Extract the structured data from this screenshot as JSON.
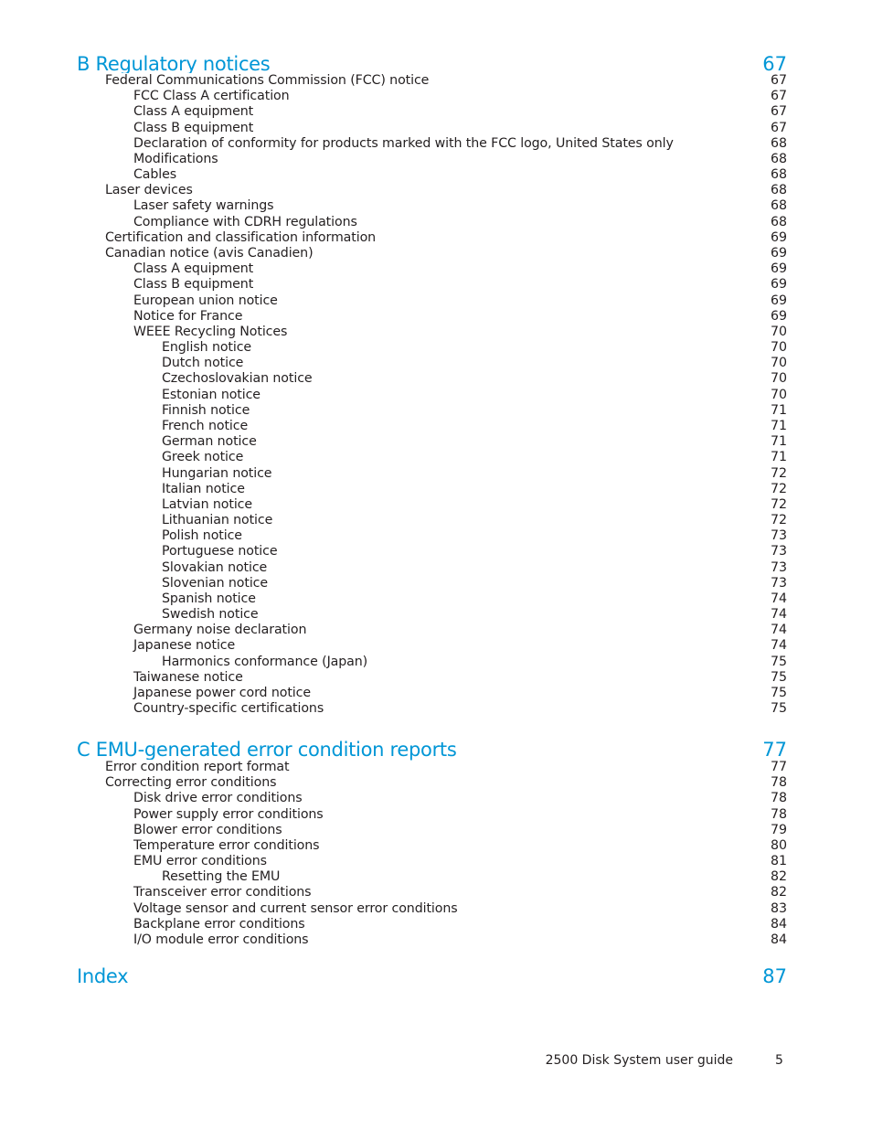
{
  "document": {
    "footer_title": "2500 Disk System user guide",
    "page_number": "5",
    "accent_color": "#0096d6"
  },
  "toc": [
    {
      "level": 0,
      "title": "B Regulatory notices",
      "page": "67"
    },
    {
      "level": 1,
      "title": "Federal Communications Commission (FCC) notice",
      "page": "67"
    },
    {
      "level": 2,
      "title": "FCC Class A certification",
      "page": "67"
    },
    {
      "level": 2,
      "title": "Class A equipment",
      "page": "67"
    },
    {
      "level": 2,
      "title": "Class B equipment",
      "page": "67"
    },
    {
      "level": 2,
      "title": "Declaration of conformity for products marked with the FCC logo, United States only",
      "page": "68"
    },
    {
      "level": 2,
      "title": "Modifications",
      "page": "68"
    },
    {
      "level": 2,
      "title": "Cables",
      "page": "68"
    },
    {
      "level": 1,
      "title": "Laser devices",
      "page": "68"
    },
    {
      "level": 2,
      "title": "Laser safety warnings",
      "page": "68"
    },
    {
      "level": 2,
      "title": "Compliance with CDRH regulations",
      "page": "68"
    },
    {
      "level": 1,
      "title": "Certification and classification information",
      "page": "69"
    },
    {
      "level": 1,
      "title": "Canadian notice (avis Canadien)",
      "page": "69"
    },
    {
      "level": 2,
      "title": "Class A equipment",
      "page": "69"
    },
    {
      "level": 2,
      "title": "Class B equipment",
      "page": "69"
    },
    {
      "level": 2,
      "title": "European union notice",
      "page": "69"
    },
    {
      "level": 2,
      "title": "Notice for France",
      "page": "69"
    },
    {
      "level": 2,
      "title": "WEEE Recycling Notices",
      "page": "70"
    },
    {
      "level": 3,
      "title": "English notice",
      "page": "70"
    },
    {
      "level": 3,
      "title": "Dutch notice",
      "page": "70"
    },
    {
      "level": 3,
      "title": "Czechoslovakian notice",
      "page": "70"
    },
    {
      "level": 3,
      "title": "Estonian notice",
      "page": "70"
    },
    {
      "level": 3,
      "title": "Finnish notice",
      "page": "71"
    },
    {
      "level": 3,
      "title": "French notice",
      "page": "71"
    },
    {
      "level": 3,
      "title": "German notice",
      "page": "71"
    },
    {
      "level": 3,
      "title": "Greek notice",
      "page": "71"
    },
    {
      "level": 3,
      "title": "Hungarian notice",
      "page": "72"
    },
    {
      "level": 3,
      "title": "Italian notice",
      "page": "72"
    },
    {
      "level": 3,
      "title": "Latvian notice",
      "page": "72"
    },
    {
      "level": 3,
      "title": "Lithuanian notice",
      "page": "72"
    },
    {
      "level": 3,
      "title": "Polish notice",
      "page": "73"
    },
    {
      "level": 3,
      "title": "Portuguese notice",
      "page": "73"
    },
    {
      "level": 3,
      "title": "Slovakian notice",
      "page": "73"
    },
    {
      "level": 3,
      "title": "Slovenian notice",
      "page": "73"
    },
    {
      "level": 3,
      "title": "Spanish notice",
      "page": "74"
    },
    {
      "level": 3,
      "title": "Swedish notice",
      "page": "74"
    },
    {
      "level": 2,
      "title": "Germany noise declaration",
      "page": "74"
    },
    {
      "level": 2,
      "title": "Japanese notice",
      "page": "74"
    },
    {
      "level": 3,
      "title": "Harmonics conformance (Japan)",
      "page": "75"
    },
    {
      "level": 2,
      "title": "Taiwanese notice",
      "page": "75"
    },
    {
      "level": 2,
      "title": "Japanese power cord notice",
      "page": "75"
    },
    {
      "level": 2,
      "title": "Country-specific certifications",
      "page": "75"
    },
    {
      "level": 0,
      "title": "C EMU-generated error condition reports",
      "page": "77"
    },
    {
      "level": 1,
      "title": "Error condition report format",
      "page": "77"
    },
    {
      "level": 1,
      "title": "Correcting error conditions",
      "page": "78"
    },
    {
      "level": 2,
      "title": "Disk drive error conditions",
      "page": "78"
    },
    {
      "level": 2,
      "title": "Power supply error conditions",
      "page": "78"
    },
    {
      "level": 2,
      "title": "Blower error conditions",
      "page": "79"
    },
    {
      "level": 2,
      "title": "Temperature error conditions",
      "page": "80"
    },
    {
      "level": 2,
      "title": "EMU error conditions",
      "page": "81"
    },
    {
      "level": 3,
      "title": "Resetting the EMU",
      "page": "82"
    },
    {
      "level": 2,
      "title": "Transceiver error conditions",
      "page": "82"
    },
    {
      "level": 2,
      "title": "Voltage sensor and current sensor error conditions",
      "page": "83"
    },
    {
      "level": 2,
      "title": "Backplane error conditions",
      "page": "84"
    },
    {
      "level": 2,
      "title": "I/O module error conditions",
      "page": "84"
    },
    {
      "level": 0,
      "title": "Index",
      "page": "87"
    }
  ]
}
